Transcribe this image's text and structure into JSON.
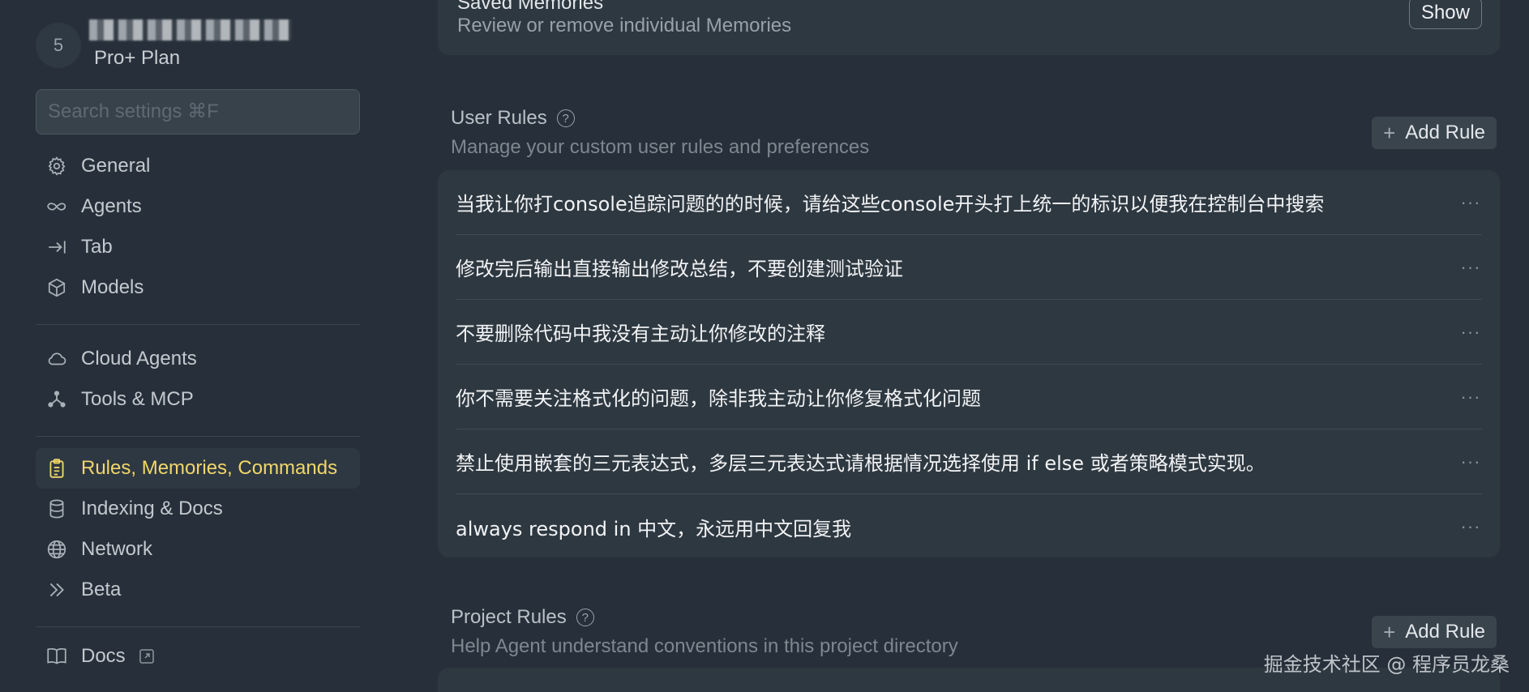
{
  "account": {
    "avatar_initial": "5",
    "plan": "Pro+ Plan"
  },
  "search": {
    "placeholder": "Search settings ⌘F"
  },
  "sidebar": {
    "group1": [
      {
        "label": "General",
        "icon": "gear-icon"
      },
      {
        "label": "Agents",
        "icon": "infinity-icon"
      },
      {
        "label": "Tab",
        "icon": "arrow-right-to-line-icon"
      },
      {
        "label": "Models",
        "icon": "cube-icon"
      }
    ],
    "group2": [
      {
        "label": "Cloud Agents",
        "icon": "cloud-icon"
      },
      {
        "label": "Tools & MCP",
        "icon": "nodes-icon"
      }
    ],
    "group3": [
      {
        "label": "Rules, Memories, Commands",
        "icon": "clipboard-icon",
        "active": true
      },
      {
        "label": "Indexing & Docs",
        "icon": "database-icon"
      },
      {
        "label": "Network",
        "icon": "globe-icon"
      },
      {
        "label": "Beta",
        "icon": "chevrons-right-icon"
      }
    ],
    "group4": [
      {
        "label": "Docs",
        "icon": "book-icon"
      }
    ]
  },
  "saved_memories": {
    "title": "Saved Memories",
    "description": "Review or remove individual Memories",
    "button": "Show"
  },
  "user_rules": {
    "title": "User Rules",
    "description": "Manage your custom user rules and preferences",
    "add_button": "Add Rule",
    "rules": [
      "当我让你打console追踪问题的的时候，请给这些console开头打上统一的标识以便我在控制台中搜索",
      "修改完后输出直接输出修改总结，不要创建测试验证",
      "不要删除代码中我没有主动让你修改的注释",
      "你不需要关注格式化的问题，除非我主动让你修复格式化问题",
      "禁止使用嵌套的三元表达式，多层三元表达式请根据情况选择使用 if else 或者策略模式实现。",
      "always respond in 中文，永远用中文回复我"
    ]
  },
  "project_rules": {
    "title": "Project Rules",
    "description": "Help Agent understand conventions in this project directory",
    "add_button": "Add Rule"
  },
  "watermark": "掘金技术社区 @ 程序员龙桑",
  "colors": {
    "background": "#27303a",
    "card": "#2e3840",
    "active_accent": "#f1d66b"
  }
}
